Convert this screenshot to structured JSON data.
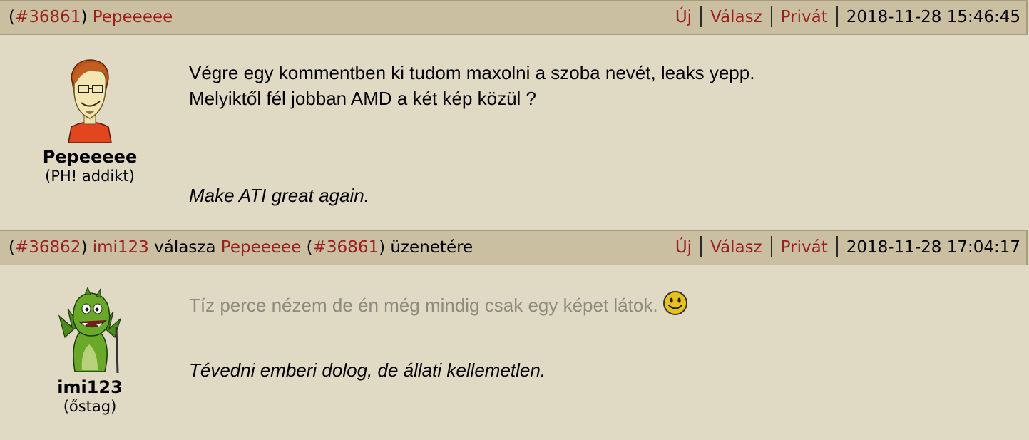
{
  "posts": [
    {
      "id": "#36861",
      "author": "Pepeeeee",
      "reply_word": "",
      "reply_to_author": "",
      "reply_to_id": "",
      "reply_suffix": "",
      "actions": {
        "new": "Új",
        "reply": "Válasz",
        "private": "Privát"
      },
      "timestamp": "2018-11-28 15:46:45",
      "user": {
        "name": "Pepeeeee",
        "rank": "(PH! addikt)",
        "avatar_icon": "cartoon-man-avatar"
      },
      "lines": [
        "Végre egy kommentben ki tudom maxolni a szoba nevét, leaks yepp.",
        "Melyiktől fél jobban AMD a két kép közül ?"
      ],
      "signature": "Make ATI great again."
    },
    {
      "id": "#36862",
      "author": "imi123",
      "reply_word": "válasza",
      "reply_to_author": "Pepeeeee",
      "reply_to_id": "#36861",
      "reply_suffix": "üzenetére",
      "actions": {
        "new": "Új",
        "reply": "Válasz",
        "private": "Privát"
      },
      "timestamp": "2018-11-28 17:04:17",
      "user": {
        "name": "imi123",
        "rank": "(őstag)",
        "avatar_icon": "green-dragon-avatar"
      },
      "lines": [
        "Tíz perce nézem de én még mindig csak egy képet látok."
      ],
      "emoji": "smiley-icon",
      "signature": "Tévedni emberi dolog, de állati kellemetlen."
    }
  ],
  "colors": {
    "header_bg": "#cbbfa2",
    "body_bg": "#e0d9c3",
    "link": "#9a1f1f",
    "muted_text": "#8f8a7e"
  }
}
